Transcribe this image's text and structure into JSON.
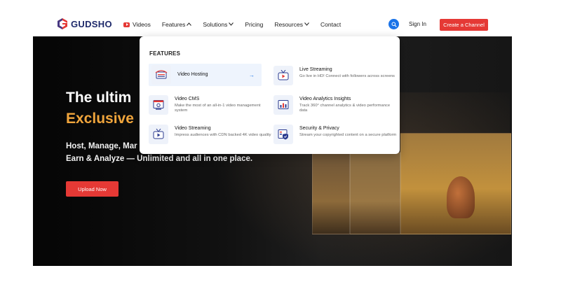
{
  "header": {
    "brand": "GUDSHO",
    "nav": [
      {
        "label": "Videos"
      },
      {
        "label": "Features",
        "chevron": "^"
      },
      {
        "label": "Solutions",
        "chevron": "v"
      },
      {
        "label": "Pricing"
      },
      {
        "label": "Resources",
        "chevron": "v"
      },
      {
        "label": "Contact"
      }
    ],
    "sign_in": "Sign In",
    "create_channel": "Create a Channel"
  },
  "hero": {
    "title_line1": "The ultim",
    "title_line2": "Exclusive",
    "subtitle_line1": "Host, Manage, Mar",
    "subtitle_line2": "Earn & Analyze — Unlimited and all in one place.",
    "upload_button": "Upload Now"
  },
  "dropdown": {
    "heading": "FEATURES",
    "features": [
      {
        "title": "Video Hosting",
        "desc": "",
        "arrow": "→"
      },
      {
        "title": "Live Streaming",
        "desc": "Go live in HD! Connect with followers across screens"
      },
      {
        "title": "Video CMS",
        "desc": "Make the most of an all-in-1 video management system"
      },
      {
        "title": "Video Analytics Insights",
        "desc": "Track 360° channel analytics & video performance data"
      },
      {
        "title": "Video Streaming",
        "desc": "Impress audiences with CDN backed 4K video quality"
      },
      {
        "title": "Security & Privacy",
        "desc": "Stream your copyrighted content on a secure platform"
      }
    ]
  },
  "colors": {
    "accent_red": "#e53935",
    "accent_blue": "#1a73e8",
    "brand_navy": "#1f2a6b",
    "hero_orange": "#f0a53c"
  }
}
